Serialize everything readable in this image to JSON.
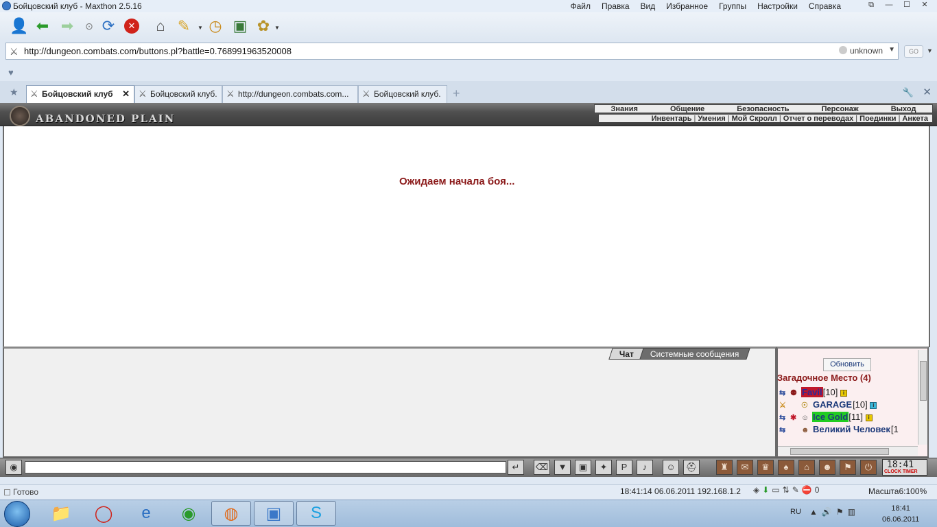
{
  "window": {
    "title": "Бойцовский клуб - Maxthon 2.5.16",
    "menu": [
      "Файл",
      "Правка",
      "Вид",
      "Избранное",
      "Группы",
      "Настройки",
      "Справка"
    ]
  },
  "address": {
    "url": "http://dungeon.combats.com/buttons.pl?battle=0.768991963520008",
    "security": "unknown",
    "go_label": "GO"
  },
  "tabs": [
    {
      "label": "Бойцовский клуб",
      "active": true
    },
    {
      "label": "Бойцовский клуб.",
      "active": false
    },
    {
      "label": "http://dungeon.combats.com...",
      "active": false
    },
    {
      "label": "Бойцовский клуб.",
      "active": false
    }
  ],
  "game": {
    "logo": "ABANDONED PLAIN",
    "menu_top": [
      "Знания",
      "Общение",
      "Безопасность",
      "Персонаж",
      "Выход"
    ],
    "menu_bottom": [
      "Инвентарь",
      "Умения",
      "Мой Скролл",
      "Отчет о переводах",
      "Поединки",
      "Анкета"
    ],
    "wait_message": "Ожидаем начала боя...",
    "chat_tabs": [
      "Чат",
      "Системные сообщения"
    ],
    "refresh_label": "Обновить",
    "location": "Загадочное Место (4)",
    "people": [
      {
        "name": "Favil",
        "level": "[10]",
        "name_color": "#2a2a9a",
        "highlight": "#c0182a",
        "info": "yellow"
      },
      {
        "name": "GARAGE",
        "level": "[10]",
        "name_color": "#1d3a7a",
        "highlight": "",
        "info": "blue"
      },
      {
        "name": "Ice Gold",
        "level": "[11]",
        "name_color": "#1d3a7a",
        "highlight": "#22cc22",
        "info": "yellow"
      },
      {
        "name": "Великий Человек",
        "level": "[1",
        "name_color": "#1d3a7a",
        "highlight": "",
        "info": ""
      }
    ],
    "clock": "18:41",
    "clock_labels": "CLOCK TIMER"
  },
  "status": {
    "ready": "Готово",
    "datetime_ip": "18:41:14 06.06.2011  192.168.1.2",
    "counter": "0",
    "zoom": "Масшта6:100%"
  },
  "taskbar": {
    "lang": "RU",
    "time": "18:41",
    "date": "06.06.2011"
  }
}
